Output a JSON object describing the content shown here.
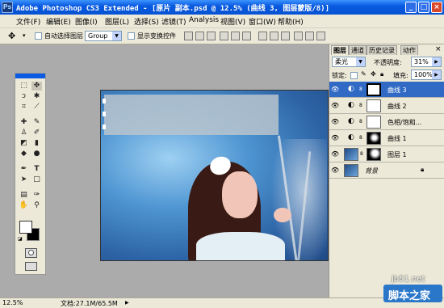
{
  "window": {
    "title": "Adobe Photoshop CS3 Extended - [原片 副本.psd @ 12.5% (曲线 3, 图层蒙版/8)]",
    "app_logo": "Ps",
    "controls": [
      "_",
      "□",
      "×"
    ]
  },
  "menu": [
    "文件(F)",
    "编辑(E)",
    "图像(I)",
    "图层(L)",
    "选择(S)",
    "滤镜(T)",
    "Analysis",
    "视图(V)",
    "窗口(W)",
    "帮助(H)"
  ],
  "options": {
    "auto_select_label": "自动选择图层",
    "group_value": "Group",
    "show_transform_label": "显示变换控件"
  },
  "panels": {
    "tabs": [
      "图层",
      "通道",
      "历史记录",
      "动作"
    ],
    "blend_mode": "柔光",
    "opacity_label": "不透明度:",
    "opacity_value": "31%",
    "lock_label": "锁定:",
    "fill_label": "填充:",
    "fill_value": "100%",
    "layers": [
      {
        "name": "曲线 3",
        "selected": true
      },
      {
        "name": "曲线 2",
        "selected": false
      },
      {
        "name": "色相/饱和...",
        "selected": false
      },
      {
        "name": "曲线 1",
        "selected": false
      },
      {
        "name": "图层 1",
        "selected": false
      },
      {
        "name": "背景",
        "selected": false
      }
    ]
  },
  "status": {
    "zoom": "12.5%",
    "doc_info": "文档:27.1M/65.5M"
  },
  "watermark": {
    "site": "jb51.net",
    "name": "脚本之家"
  },
  "colors": {
    "title_bar": "#0A5BE1",
    "selection": "#316AC5",
    "chrome": "#ECE9D8",
    "workspace": "#ABABAB"
  }
}
